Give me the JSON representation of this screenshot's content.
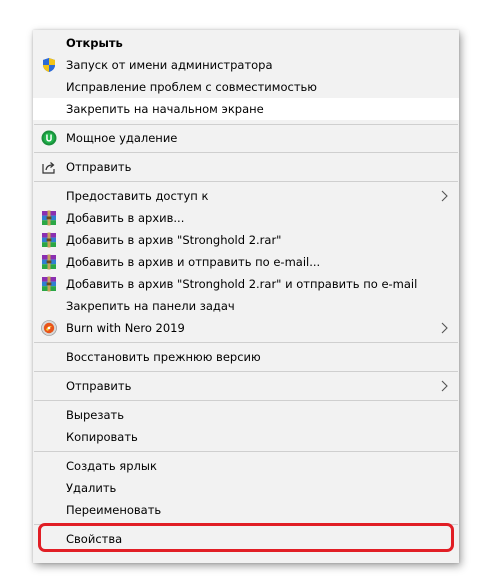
{
  "menu": {
    "items": [
      {
        "label": "Открыть",
        "icon": "none"
      },
      {
        "label": "Запуск от имени администратора",
        "icon": "uac-shield-icon"
      },
      {
        "label": "Исправление проблем с совместимостью",
        "icon": "none"
      },
      {
        "label": "Закрепить на начальном экране",
        "icon": "none"
      },
      {
        "label": "Мощное удаление",
        "icon": "uninstall-tool-icon"
      },
      {
        "label": "Отправить",
        "icon": "share-icon"
      },
      {
        "label": "Предоставить доступ к",
        "icon": "none",
        "submenu": true
      },
      {
        "label": "Добавить в архив...",
        "icon": "winrar-icon"
      },
      {
        "label": "Добавить в архив \"Stronghold 2.rar\"",
        "icon": "winrar-icon"
      },
      {
        "label": "Добавить в архив и отправить по e-mail...",
        "icon": "winrar-icon"
      },
      {
        "label": "Добавить в архив \"Stronghold 2.rar\" и отправить по e-mail",
        "icon": "winrar-icon"
      },
      {
        "label": "Закрепить на панели задач",
        "icon": "none"
      },
      {
        "label": "Burn with Nero 2019",
        "icon": "nero-icon",
        "submenu": true
      },
      {
        "label": "Восстановить прежнюю версию",
        "icon": "none"
      },
      {
        "label": "Отправить",
        "icon": "none",
        "submenu": true
      },
      {
        "label": "Вырезать",
        "icon": "none"
      },
      {
        "label": "Копировать",
        "icon": "none"
      },
      {
        "label": "Создать ярлык",
        "icon": "none"
      },
      {
        "label": "Удалить",
        "icon": "none"
      },
      {
        "label": "Переименовать",
        "icon": "none"
      },
      {
        "label": "Свойства",
        "icon": "none"
      }
    ]
  },
  "colors": {
    "menu_background": "#f2f2f2",
    "hover_background": "#ffffff",
    "separator": "#cfcfcf",
    "highlight_ring": "#e11e25"
  }
}
